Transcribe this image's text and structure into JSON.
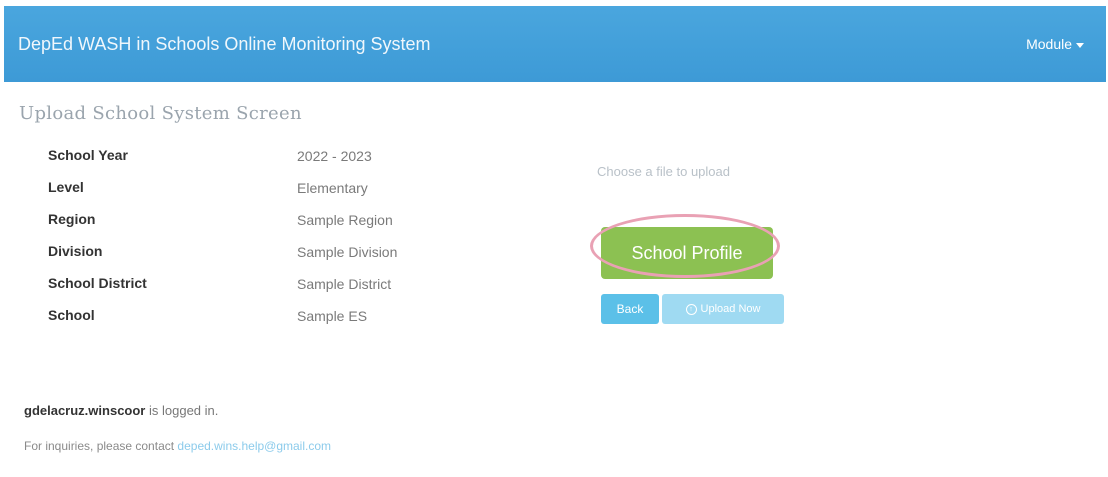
{
  "navbar": {
    "title": "DepEd WASH in Schools Online Monitoring System",
    "module_menu": "Module"
  },
  "panel": {
    "title": "Upload School System Screen",
    "fields": [
      {
        "label": "School Year",
        "value": "2022 - 2023"
      },
      {
        "label": "Level",
        "value": "Elementary"
      },
      {
        "label": "Region",
        "value": "Sample Region"
      },
      {
        "label": "Division",
        "value": "Sample Division"
      },
      {
        "label": "School District",
        "value": "Sample District"
      },
      {
        "label": "School",
        "value": "Sample ES"
      }
    ]
  },
  "upload": {
    "hint": "Choose a file to upload",
    "profile_button": "School Profile",
    "back_button": "Back",
    "upload_button": "Upload Now"
  },
  "footer": {
    "username": "gdelacruz.winscoor",
    "logged_text": " is logged in.",
    "contact_text": "For inquiries, please contact ",
    "contact_email": "deped.wins.help@gmail.com"
  },
  "colors": {
    "navbar": "#3d9ad6",
    "profile_button": "#8cc152",
    "highlight_ring": "#e9a1b4",
    "back_button": "#5bc0e8",
    "upload_button": "#9fdaf2"
  }
}
